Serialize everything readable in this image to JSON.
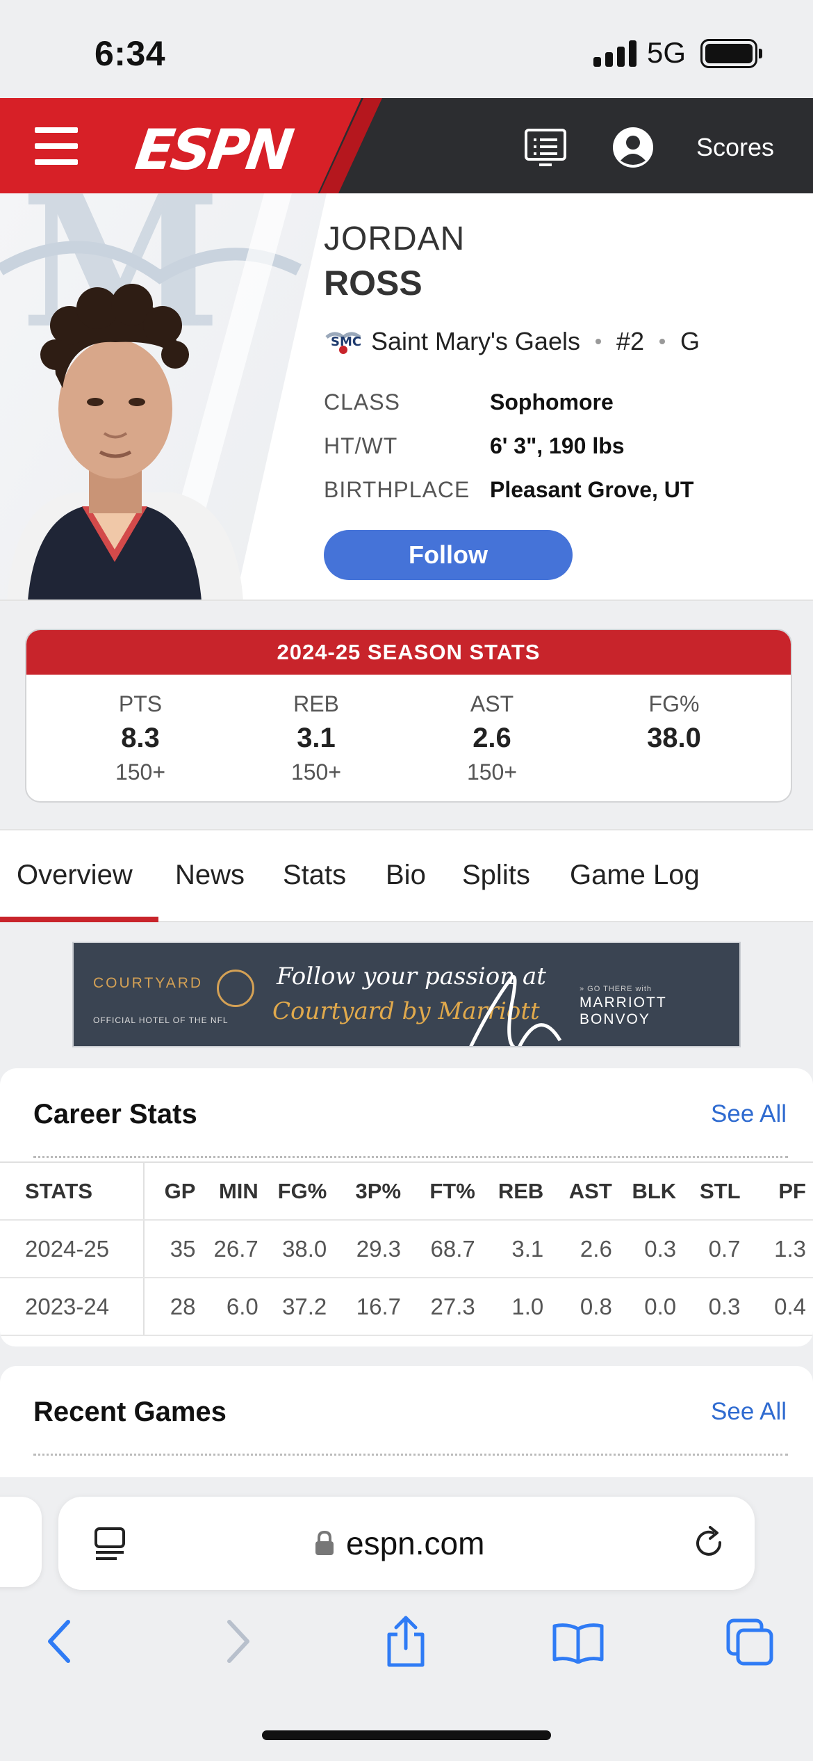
{
  "status_bar": {
    "time": "6:34",
    "network": "5G"
  },
  "header": {
    "logo": "ESPN",
    "menu_icon": "hamburger-menu-icon",
    "scores_label": "Scores"
  },
  "player": {
    "first_name": "JORDAN",
    "last_name": "ROSS",
    "team": "Saint Mary's Gaels",
    "number": "#2",
    "position": "G",
    "bio": [
      {
        "key": "CLASS",
        "value": "Sophomore"
      },
      {
        "key": "HT/WT",
        "value": "6' 3\", 190 lbs"
      },
      {
        "key": "BIRTHPLACE",
        "value": "Pleasant Grove, UT"
      }
    ],
    "follow_label": "Follow"
  },
  "season_stats": {
    "title": "2024-25 SEASON STATS",
    "stats": [
      {
        "label": "PTS",
        "value": "8.3",
        "rank": "150+"
      },
      {
        "label": "REB",
        "value": "3.1",
        "rank": "150+"
      },
      {
        "label": "AST",
        "value": "2.6",
        "rank": "150+"
      },
      {
        "label": "FG%",
        "value": "38.0",
        "rank": ""
      }
    ]
  },
  "tabs": [
    "Overview",
    "News",
    "Stats",
    "Bio",
    "Splits",
    "Game Log"
  ],
  "ad": {
    "brand": "COURTYARD",
    "brand_sub": "OFFICIAL HOTEL OF THE NFL",
    "line1": "Follow your passion at",
    "line2": "Courtyard by Marriott",
    "bonvoy_small": "» GO THERE with",
    "bonvoy": "MARRIOTT BONVOY"
  },
  "career_stats": {
    "title": "Career Stats",
    "see_all": "See All",
    "columns": [
      "STATS",
      "GP",
      "MIN",
      "FG%",
      "3P%",
      "FT%",
      "REB",
      "AST",
      "BLK",
      "STL",
      "PF"
    ],
    "rows": [
      [
        "2024-25",
        "35",
        "26.7",
        "38.0",
        "29.3",
        "68.7",
        "3.1",
        "2.6",
        "0.3",
        "0.7",
        "1.3"
      ],
      [
        "2023-24",
        "28",
        "6.0",
        "37.2",
        "16.7",
        "27.3",
        "1.0",
        "0.8",
        "0.0",
        "0.3",
        "0.4"
      ]
    ]
  },
  "recent_games": {
    "title": "Recent Games",
    "see_all": "See All"
  },
  "browser": {
    "url": "espn.com"
  },
  "colors": {
    "espn_red": "#d72027",
    "follow_blue": "#4573d8",
    "link_blue": "#2f6bd0",
    "season_red": "#c8242b"
  }
}
